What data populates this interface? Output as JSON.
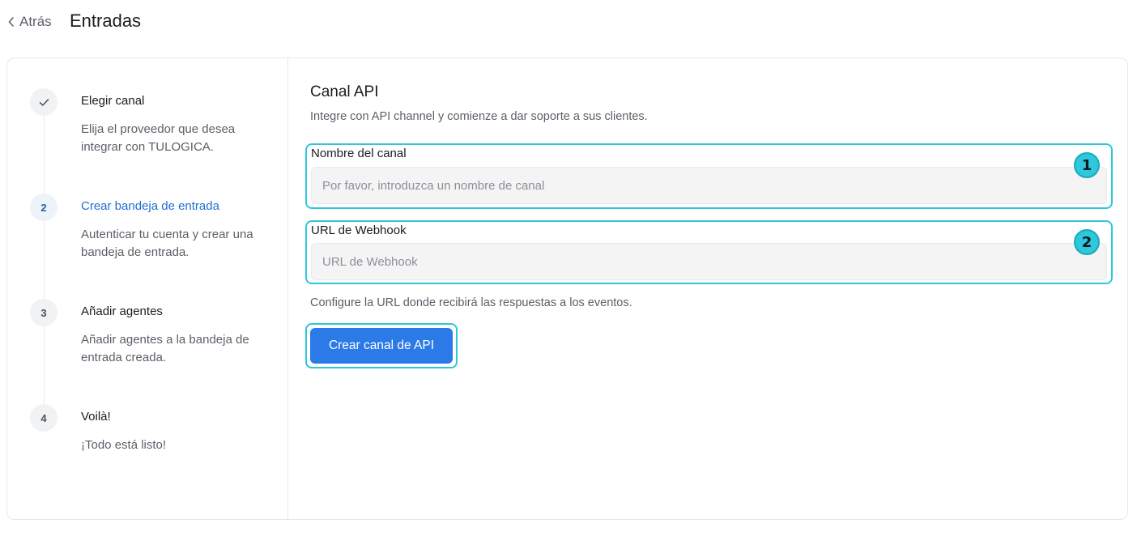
{
  "header": {
    "back_label": "Atrás",
    "title": "Entradas"
  },
  "steps": [
    {
      "marker": "",
      "icon": "check-icon",
      "title": "Elegir canal",
      "desc": "Elija el proveedor que desea integrar con TULOGICA.",
      "state": "done"
    },
    {
      "marker": "2",
      "title": "Crear bandeja de entrada",
      "desc": "Autenticar tu cuenta y crear una bandeja de entrada.",
      "state": "active"
    },
    {
      "marker": "3",
      "title": "Añadir agentes",
      "desc": "Añadir agentes a la bandeja de entrada creada.",
      "state": "pending"
    },
    {
      "marker": "4",
      "title": "Voilà!",
      "desc": "¡Todo está listo!",
      "state": "pending"
    }
  ],
  "form": {
    "heading": "Canal API",
    "subheading": "Integre con API channel y comienze a dar soporte a sus clientes.",
    "channel_name": {
      "label": "Nombre del canal",
      "value": "",
      "placeholder": "Por favor, introduzca un nombre de canal",
      "badge": "1"
    },
    "webhook_url": {
      "label": "URL de Webhook",
      "value": "",
      "placeholder": "URL de Webhook",
      "badge": "2"
    },
    "hint": "Configure la URL donde recibirá las respuestas a los eventos.",
    "submit_label": "Crear canal de API"
  },
  "colors": {
    "accent": "#2b7ae8",
    "highlight": "#2ec7dc",
    "active_step": "#1f6fd1"
  }
}
